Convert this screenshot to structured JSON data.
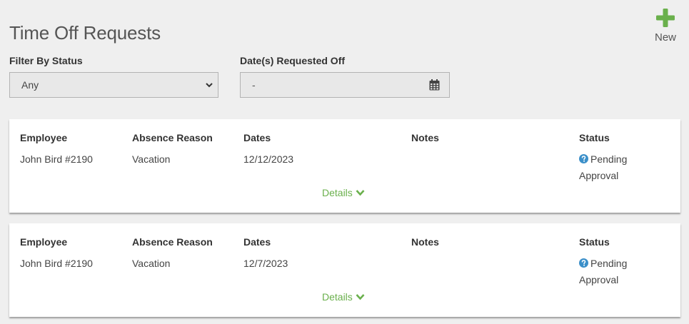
{
  "header": {
    "title": "Time Off Requests",
    "new_label": "New"
  },
  "filters": {
    "status_label": "Filter By Status",
    "status_value": "Any",
    "dates_label": "Date(s) Requested Off",
    "dates_value": "-"
  },
  "columns": {
    "employee": "Employee",
    "reason": "Absence Reason",
    "dates": "Dates",
    "notes": "Notes",
    "status": "Status"
  },
  "requests": [
    {
      "employee": "John Bird #2190",
      "reason": "Vacation",
      "dates": "12/12/2023",
      "notes": "",
      "status": "Pending Approval",
      "details_label": "Details"
    },
    {
      "employee": "John Bird #2190",
      "reason": "Vacation",
      "dates": "12/7/2023",
      "notes": "",
      "status": "Pending Approval",
      "details_label": "Details"
    }
  ],
  "colors": {
    "accent_green": "#6ab04c",
    "help_blue": "#3b8fc9",
    "background": "#efefef"
  },
  "icons": {
    "new": "plus-icon",
    "select": "chevron-down-icon",
    "date": "calendar-icon",
    "status": "question-circle-icon",
    "details": "chevron-down-icon"
  }
}
